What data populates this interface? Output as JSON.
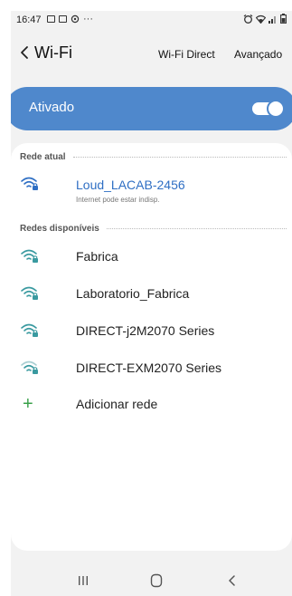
{
  "status_bar": {
    "time": "16:47",
    "dots": "···"
  },
  "header": {
    "title": "Wi-Fi",
    "wifi_direct_label": "Wi-Fi Direct",
    "advanced_label": "Avançado"
  },
  "toggle": {
    "label": "Ativado",
    "state": "on",
    "accent_color": "#4f88cc"
  },
  "current_section": {
    "label": "Rede atual",
    "network": {
      "name": "Loud_LACAB-2456",
      "status": "Internet pode estar indisp.",
      "icon": "wifi-locked-icon"
    }
  },
  "available_section": {
    "label": "Redes disponíveis",
    "networks": [
      {
        "name": "Fabrica",
        "icon": "wifi-locked-icon"
      },
      {
        "name": "Laboratorio_Fabrica",
        "icon": "wifi-locked-icon"
      },
      {
        "name": "DIRECT-j2M2070 Series",
        "icon": "wifi-locked-icon"
      },
      {
        "name": "DIRECT-EXM2070 Series",
        "icon": "wifi-locked-weak-icon"
      }
    ]
  },
  "add_network": {
    "label": "Adicionar rede",
    "icon": "plus-icon",
    "color": "#3aa14a"
  },
  "nav_bar": {
    "items": [
      "recent-apps-icon",
      "home-icon",
      "back-icon"
    ]
  }
}
